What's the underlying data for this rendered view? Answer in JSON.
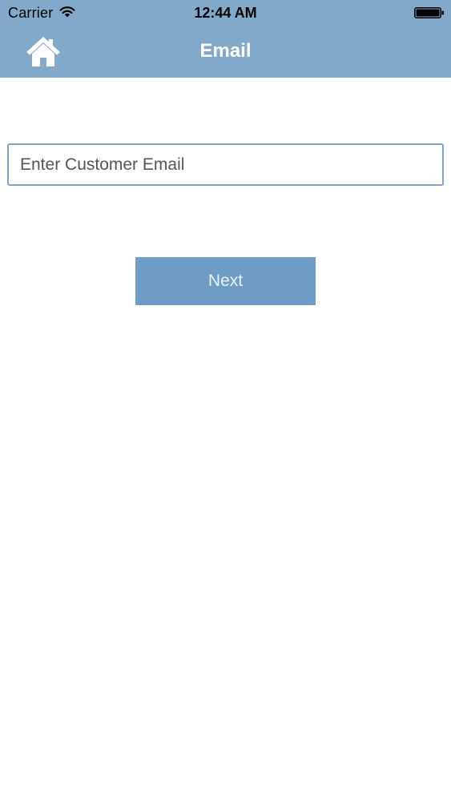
{
  "status_bar": {
    "carrier": "Carrier",
    "time": "12:44 AM",
    "wifi_icon": "wifi-icon",
    "battery_icon": "battery-full-icon"
  },
  "nav": {
    "title": "Email",
    "home_icon": "home-icon"
  },
  "form": {
    "email_placeholder": "Enter Customer Email",
    "email_value": "",
    "next_label": "Next"
  },
  "colors": {
    "header_background": "#82a9ca",
    "field_border": "#7aa6cc",
    "button_background": "#6f9cc4",
    "page_background": "#ffffff"
  }
}
